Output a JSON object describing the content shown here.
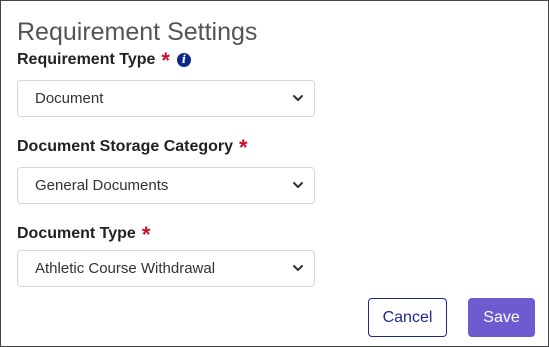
{
  "panel": {
    "title": "Requirement Settings"
  },
  "fields": [
    {
      "label": "Requirement Type",
      "required_marker": "*",
      "has_info_icon": true,
      "info_icon": "info-icon",
      "value": "Document"
    },
    {
      "label": "Document Storage Category",
      "required_marker": "*",
      "value": "General Documents"
    },
    {
      "label": "Document Type",
      "required_marker": "*",
      "value": "Athletic Course Withdrawal"
    }
  ],
  "buttons": {
    "cancel_label": "Cancel",
    "save_label": "Save"
  },
  "colors": {
    "required": "#c8102e",
    "info_icon": "#0a2a8a",
    "cancel_border": "#1e2a8a",
    "save_background": "#6f5bd0"
  }
}
